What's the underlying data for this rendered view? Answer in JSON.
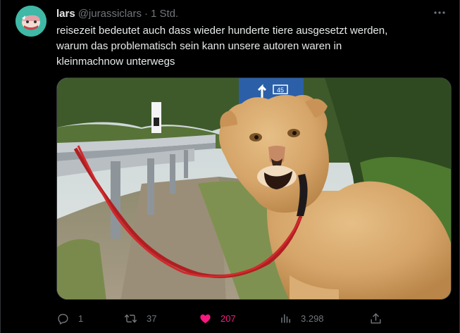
{
  "tweet": {
    "display_name": "lars",
    "handle": "@jurassiclars",
    "separator": "·",
    "time": "1 Std.",
    "text_lines": [
      "reisezeit bedeutet auch dass wieder hunderte tiere ausgesetzt werden,",
      "warum das problematisch sein kann unsere autoren waren in",
      "kleinmachnow unterwegs"
    ],
    "sign_text": "45"
  },
  "actions": {
    "reply_count": "1",
    "retweet_count": "37",
    "like_count": "207",
    "view_count": "3.298"
  },
  "icons": {
    "more": "more-dots-icon",
    "reply": "reply-icon",
    "retweet": "retweet-icon",
    "like": "heart-icon",
    "views": "views-bar-chart-icon",
    "share": "share-icon"
  },
  "colors": {
    "background": "#000000",
    "text": "#e7e9ea",
    "muted": "#71767b",
    "like": "#f91880",
    "avatar_bg": "#3fb8a6"
  }
}
